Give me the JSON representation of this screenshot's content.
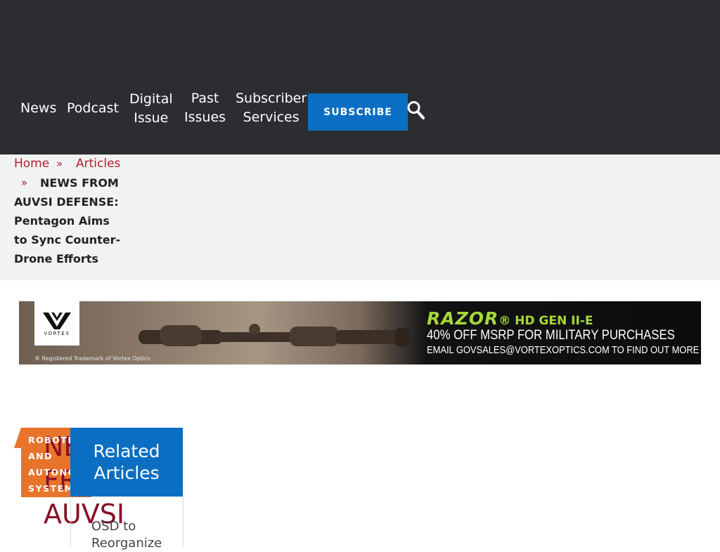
{
  "nav": {
    "items": [
      {
        "label": "News"
      },
      {
        "label": "Podcast"
      },
      {
        "label_line1": "Digital",
        "label_line2": "Issue"
      },
      {
        "label_line1": "Past",
        "label_line2": "Issues"
      },
      {
        "label_line1": "Subscriber",
        "label_line2": "Services"
      }
    ],
    "subscribe_label": "SUBSCRIBE",
    "search_icon": "search-icon"
  },
  "breadcrumb": {
    "home": "Home",
    "articles": "Articles",
    "separator": "»",
    "current": "NEWS FROM AUVSI DEFENSE: Pentagon Aims to Sync Counter-Drone Efforts"
  },
  "ad": {
    "logo_text": "VORTEX",
    "trademark": "® Registered Trademark of Vortex Optics",
    "product": "RAZOR",
    "product_suffix": "® HD GEN II-E",
    "line1": "40% OFF MSRP FOR MILITARY PURCHASES",
    "line2": "EMAIL GOVSALES@VORTEXOPTICS.COM TO FIND OUT MORE",
    "accent_color": "#a4d83a"
  },
  "article": {
    "category": "ROBOTICS AND AUTONOMOUS SYSTEMS",
    "title": "NEWS FROM AUVSI"
  },
  "related": {
    "heading": "Related Articles",
    "first_item": "OSD to Reorganize"
  },
  "colors": {
    "header_bg": "#2b2d31",
    "primary_blue": "#0a6fc2",
    "crumb_red": "#b01e2e",
    "category_orange": "#e8742b",
    "title_red": "#8a1026"
  }
}
